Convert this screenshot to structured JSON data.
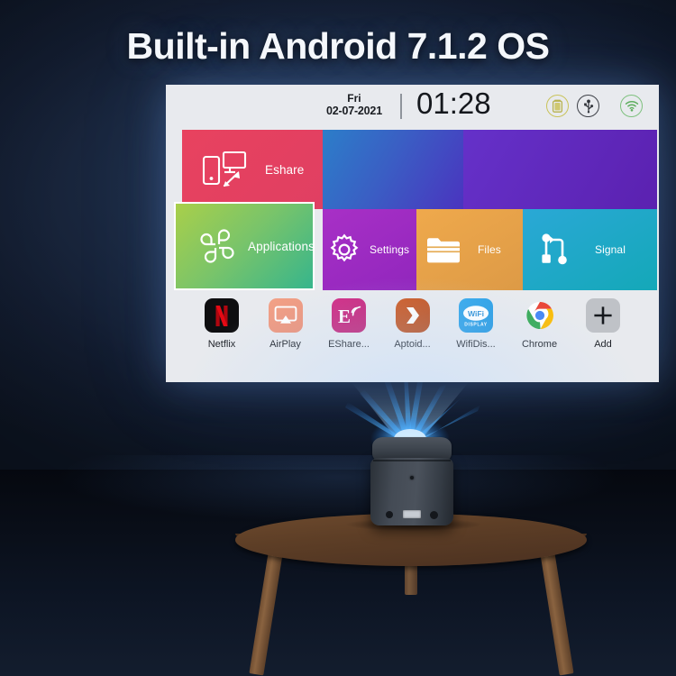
{
  "title": "Built-in Android 7.1.2 OS",
  "screen": {
    "statusbar": {
      "day": "Fri",
      "date": "02-07-2021",
      "time": "01:28",
      "icons": [
        {
          "name": "battery-icon",
          "label": "battery",
          "color": "#c9c35a"
        },
        {
          "name": "usb-icon",
          "label": "usb",
          "color": "#3c3f46"
        },
        {
          "name": "wifi-icon",
          "label": "wifi",
          "color": "#7ec17e"
        }
      ]
    },
    "tiles": [
      {
        "id": "eshare",
        "label": "Eshare",
        "icon": "screen-cast-icon",
        "color": "#e8425f",
        "selected": false
      },
      {
        "id": "blue",
        "label": "",
        "icon": "",
        "color": "#3a5fc4",
        "selected": false
      },
      {
        "id": "purple",
        "label": "",
        "icon": "",
        "color": "#5b21b0",
        "selected": false
      },
      {
        "id": "applications",
        "label": "Applications",
        "icon": "clover-grid-icon",
        "color": "#79c46a",
        "selected": true
      },
      {
        "id": "settings",
        "label": "Settings",
        "icon": "gear-icon",
        "color": "#9126bd",
        "selected": false
      },
      {
        "id": "files",
        "label": "Files",
        "icon": "folder-icon",
        "color": "#dd9a46",
        "selected": false
      },
      {
        "id": "signal",
        "label": "Signal",
        "icon": "signal-nodes-icon",
        "color": "#14a8b8",
        "selected": false
      }
    ],
    "apps": [
      {
        "id": "netflix",
        "label": "Netflix",
        "icon": "netflix-icon",
        "color": "#0e0e10"
      },
      {
        "id": "airplay",
        "label": "AirPlay",
        "icon": "airplay-icon",
        "color": "#ec8f76"
      },
      {
        "id": "eshare",
        "label": "EShare...",
        "icon": "eshare-icon",
        "color": "#bc1f73"
      },
      {
        "id": "aptoide",
        "label": "Aptoid...",
        "icon": "aptoide-icon",
        "color": "#b4491a"
      },
      {
        "id": "wifidis",
        "label": "WifiDis...",
        "icon": "wifi-display-icon",
        "color": "#1f95de"
      },
      {
        "id": "chrome",
        "label": "Chrome",
        "icon": "chrome-icon",
        "color": "#4285f4"
      },
      {
        "id": "add",
        "label": "Add",
        "icon": "plus-icon",
        "color": "#bfc2c7"
      }
    ]
  },
  "scene": {
    "device": "mini-projector",
    "beam_color": "#3da5ff",
    "wall_color": "#1b2941",
    "floor_color": "#0a1018",
    "table": "round-wooden-side-table"
  }
}
